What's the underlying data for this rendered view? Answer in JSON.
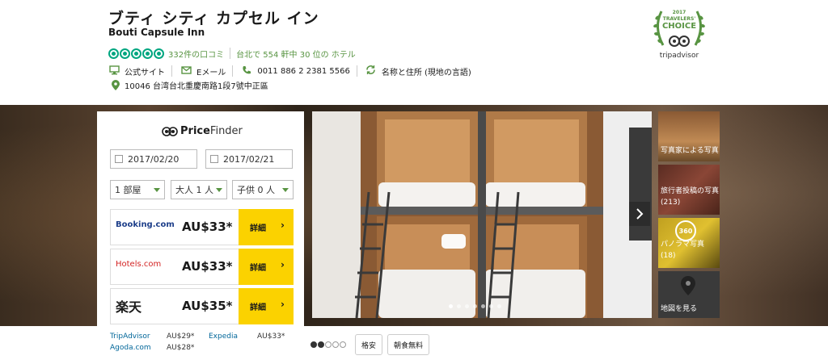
{
  "header": {
    "title_jp": "ブティ シティ カプセル イン",
    "title_en": "Bouti Capsule Inn",
    "reviews": "332件の口コミ",
    "rank": "台北で 554 軒中 30 位の ホテル",
    "website": "公式サイト",
    "email": "Eメール",
    "phone": "0011 886 2 2381 5566",
    "name_address": "名称と住所 (現地の言語)",
    "address": "10046 台湾台北重慶南路1段7號中正區"
  },
  "badge": {
    "year": "2017",
    "line1": "TRAVELERS'",
    "line2": "CHOICE",
    "brand": "tripadvisor"
  },
  "price_finder": {
    "title_bold": "Price",
    "title_rest": "Finder",
    "checkin": "2017/02/20",
    "checkout": "2017/02/21",
    "rooms": "1 部屋",
    "adults": "大人 1 人",
    "children": "子供 0 人",
    "offers": [
      {
        "brand": "Booking.com",
        "price": "AU$33*",
        "button": "詳細"
      },
      {
        "brand": "Hotels.com",
        "price": "AU$33*",
        "button": "詳細"
      },
      {
        "brand": "楽天",
        "price": "AU$35*",
        "button": "詳細"
      }
    ],
    "more": [
      {
        "brand": "TripAdvisor",
        "price": "AU$29*"
      },
      {
        "brand": "Expedia",
        "price": "AU$33*"
      },
      {
        "brand": "Agoda.com",
        "price": "AU$28*"
      }
    ]
  },
  "gallery": {
    "thumbs": [
      {
        "label": "写真家による写真"
      },
      {
        "label": "旅行者投稿の写真",
        "count": "(213)"
      },
      {
        "label": "パノラマ写真",
        "count": "(18)",
        "badge": "360"
      },
      {
        "label": "地図を見る"
      }
    ]
  },
  "below": {
    "class_label": "格安",
    "amenity": "朝食無料"
  },
  "colors": {
    "accent": "#589442",
    "bubble": "#00a680",
    "button": "#fbd200",
    "link": "#006699"
  }
}
